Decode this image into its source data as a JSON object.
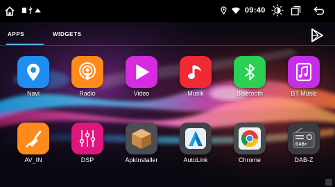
{
  "status_bar": {
    "time": "09:40",
    "icons": [
      "home-icon",
      "notification-icon",
      "usb-icon",
      "cloud-icon",
      "location-icon",
      "wifi-icon",
      "brightness-icon",
      "recent-apps-icon",
      "back-icon"
    ]
  },
  "tabs": [
    {
      "label": "APPS",
      "active": true
    },
    {
      "label": "WIDGETS",
      "active": false
    }
  ],
  "store_icon": "play-store-icon",
  "apps": [
    {
      "label": "Navi",
      "icon": "navi-pin-icon",
      "color": "#1f8ef1"
    },
    {
      "label": "Radio",
      "icon": "radio-podcast-icon",
      "color": "#ff8a1c"
    },
    {
      "label": "Video",
      "icon": "video-play-icon",
      "color": "#d62be0"
    },
    {
      "label": "Musik",
      "icon": "music-note-icon",
      "color": "#ef2a34"
    },
    {
      "label": "Bluetooth",
      "icon": "bluetooth-icon",
      "color": "#2bcf53"
    },
    {
      "label": "BT Music",
      "icon": "bt-music-icon",
      "color": "#c62de8"
    },
    {
      "label": "AV_IN",
      "icon": "av-in-cable-icon",
      "color": "#ff8a1c"
    },
    {
      "label": "DSP",
      "icon": "dsp-equalizer-icon",
      "color": "#e0167f"
    },
    {
      "label": "ApkInstaller",
      "icon": "apk-box-icon",
      "color": "#4a4d52"
    },
    {
      "label": "AutoLink",
      "icon": "autolink-icon",
      "color": "#3f4247"
    },
    {
      "label": "Chrome",
      "icon": "chrome-icon",
      "color": "#474a4f"
    },
    {
      "label": "DAB-Z",
      "icon": "dab-radio-icon",
      "color": "#3a3c40"
    }
  ],
  "dab_icon_text": "DAB+"
}
